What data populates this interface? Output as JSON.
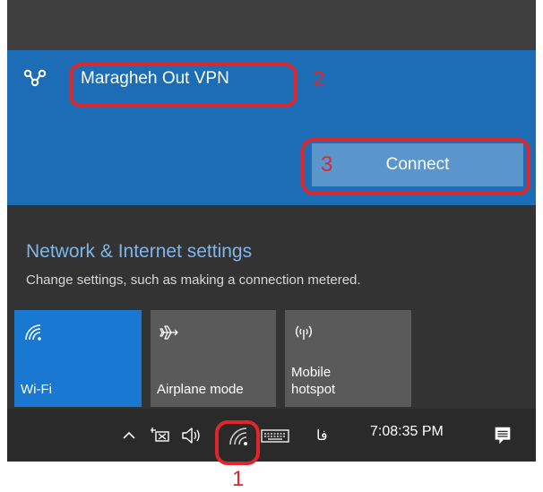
{
  "vpn": {
    "name": "Maragheh Out VPN",
    "connect_label": "Connect"
  },
  "settings": {
    "title": "Network & Internet settings",
    "subtitle": "Change settings, such as making a connection metered."
  },
  "tiles": [
    {
      "label": "Wi-Fi",
      "icon": "wifi-icon",
      "active": true
    },
    {
      "label": "Airplane mode",
      "icon": "airplane-icon",
      "active": false
    },
    {
      "label": "Mobile\nhotspot",
      "icon": "hotspot-icon",
      "active": false
    }
  ],
  "taskbar": {
    "language": "فا",
    "clock": "7:08:35 PM"
  },
  "annotations": {
    "n1": "1",
    "n2": "2",
    "n3": "3"
  },
  "colors": {
    "accent": "#1c6db5",
    "tile_active": "#1878d2",
    "annotation": "#e0262a",
    "link": "#7fb6ea"
  }
}
